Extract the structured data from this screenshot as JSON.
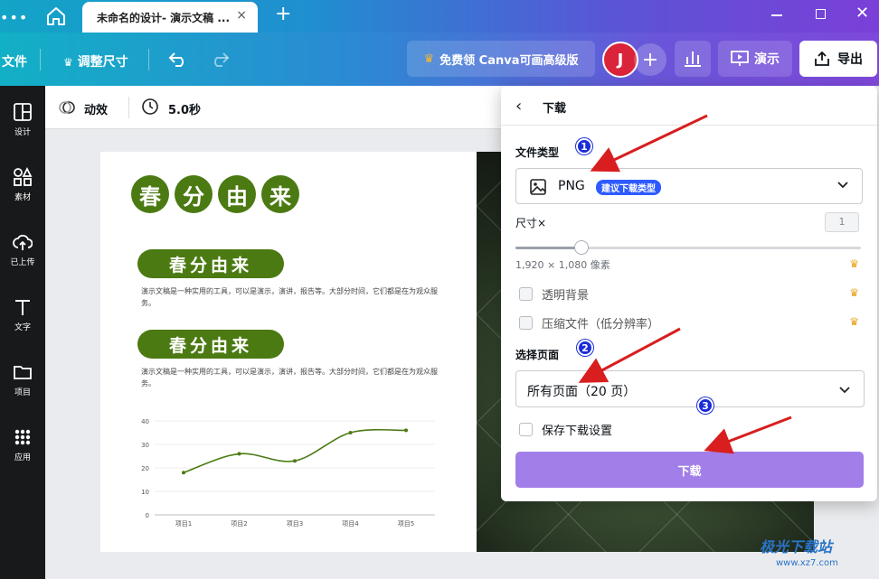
{
  "window": {
    "tab_title": "未命名的设计- 演示文稿 ...",
    "tab_close": "×",
    "new_tab": "+",
    "menu_dots": "•••"
  },
  "toolbar": {
    "file": "文件",
    "resize": "调整尺寸",
    "upgrade": "免费领 Canva可画高级版",
    "avatar_initial": "J",
    "add": "+",
    "present": "演示",
    "export": "导出"
  },
  "rail": [
    {
      "label": "设计",
      "icon": "layout-icon"
    },
    {
      "label": "素材",
      "icon": "elements-icon"
    },
    {
      "label": "已上传",
      "icon": "upload-cloud-icon"
    },
    {
      "label": "文字",
      "icon": "text-icon"
    },
    {
      "label": "项目",
      "icon": "folder-icon"
    },
    {
      "label": "应用",
      "icon": "apps-grid-icon"
    }
  ],
  "subbar": {
    "animate": "动效",
    "duration": "5.0秒"
  },
  "slide": {
    "title_chars": [
      "春",
      "分",
      "由",
      "来"
    ],
    "section1_title": "春分由来",
    "section1_body": "演示文稿是一种实用的工具，可以是演示，演讲，报告等。大部分时间，它们都是在为观众服务。",
    "section2_title": "春分由来",
    "section2_body": "演示文稿是一种实用的工具，可以是演示，演讲，报告等。大部分时间，它们都是在为观众服务。"
  },
  "chart_data": {
    "type": "line",
    "categories": [
      "项目1",
      "项目2",
      "项目3",
      "项目4",
      "项目5"
    ],
    "values": [
      18,
      26,
      23,
      35,
      36
    ],
    "ylim": [
      0,
      40
    ],
    "yticks": [
      0,
      10,
      20,
      30,
      40
    ],
    "color": "#4b7a12",
    "grid": true
  },
  "panel": {
    "title": "下载",
    "file_type_label": "文件类型",
    "file_type_value": "PNG",
    "file_type_badge": "建议下载类型",
    "size_label": "尺寸×",
    "size_value": "1",
    "size_fraction": 0.19,
    "dims": "1,920 × 1,080 像素",
    "transparent_bg": "透明背景",
    "compress": "压缩文件（低分辨率）",
    "pages_label": "选择页面",
    "pages_value": "所有页面（20 页）",
    "save_settings": "保存下载设置",
    "download_button": "下载"
  },
  "markers": [
    "1",
    "2",
    "3"
  ],
  "watermark": {
    "title": "极光下载站",
    "url": "www.xz7.com"
  }
}
